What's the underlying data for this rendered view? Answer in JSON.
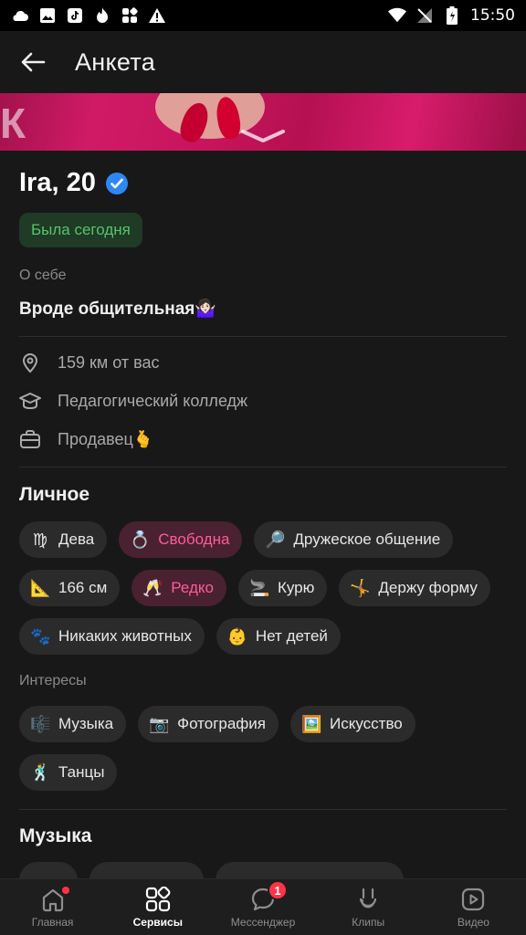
{
  "status_bar": {
    "time": "15:50"
  },
  "header": {
    "title": "Анкета"
  },
  "profile": {
    "name": "Ira, 20",
    "online_status": "Была сегодня",
    "about_label": "О себе",
    "about_text": "Вроде общительная🤷🏻‍♀️"
  },
  "info": [
    {
      "icon": "location-icon",
      "text": "159 км от вас"
    },
    {
      "icon": "education-icon",
      "text": "Педагогический колледж"
    },
    {
      "icon": "briefcase-icon",
      "text": "Продавец🫰"
    }
  ],
  "personal": {
    "title": "Личное",
    "chips": [
      {
        "emoji": "♍",
        "label": "Дева"
      },
      {
        "emoji": "💍",
        "label": "Свободна",
        "highlight": true
      },
      {
        "emoji": "🔎",
        "label": "Дружеское общение"
      },
      {
        "emoji": "📐",
        "label": "166 см"
      },
      {
        "emoji": "🥂",
        "label": "Редко",
        "highlight": true
      },
      {
        "emoji": "🚬",
        "label": "Курю"
      },
      {
        "emoji": "🤸",
        "label": "Держу форму"
      },
      {
        "emoji": "🐾",
        "label": "Никаких животных"
      },
      {
        "emoji": "👶",
        "label": "Нет детей"
      }
    ]
  },
  "interests": {
    "title": "Интересы",
    "chips": [
      {
        "emoji": "🎼",
        "label": "Музыка"
      },
      {
        "emoji": "📷",
        "label": "Фотография"
      },
      {
        "emoji": "🖼️",
        "label": "Искусство"
      },
      {
        "emoji": "🕺",
        "label": "Танцы"
      }
    ]
  },
  "music": {
    "title": "Музыка"
  },
  "nav": {
    "items": [
      {
        "label": "Главная",
        "icon": "home-icon"
      },
      {
        "label": "Сервисы",
        "icon": "services-icon",
        "active": true
      },
      {
        "label": "Мессенджер",
        "icon": "messenger-icon",
        "badge": "1"
      },
      {
        "label": "Клипы",
        "icon": "clips-icon"
      },
      {
        "label": "Видео",
        "icon": "video-icon"
      }
    ]
  },
  "colors": {
    "accent": "#ff5c9a",
    "online": "#57c46a",
    "verified": "#2e87f5",
    "badge": "#ff3347"
  }
}
